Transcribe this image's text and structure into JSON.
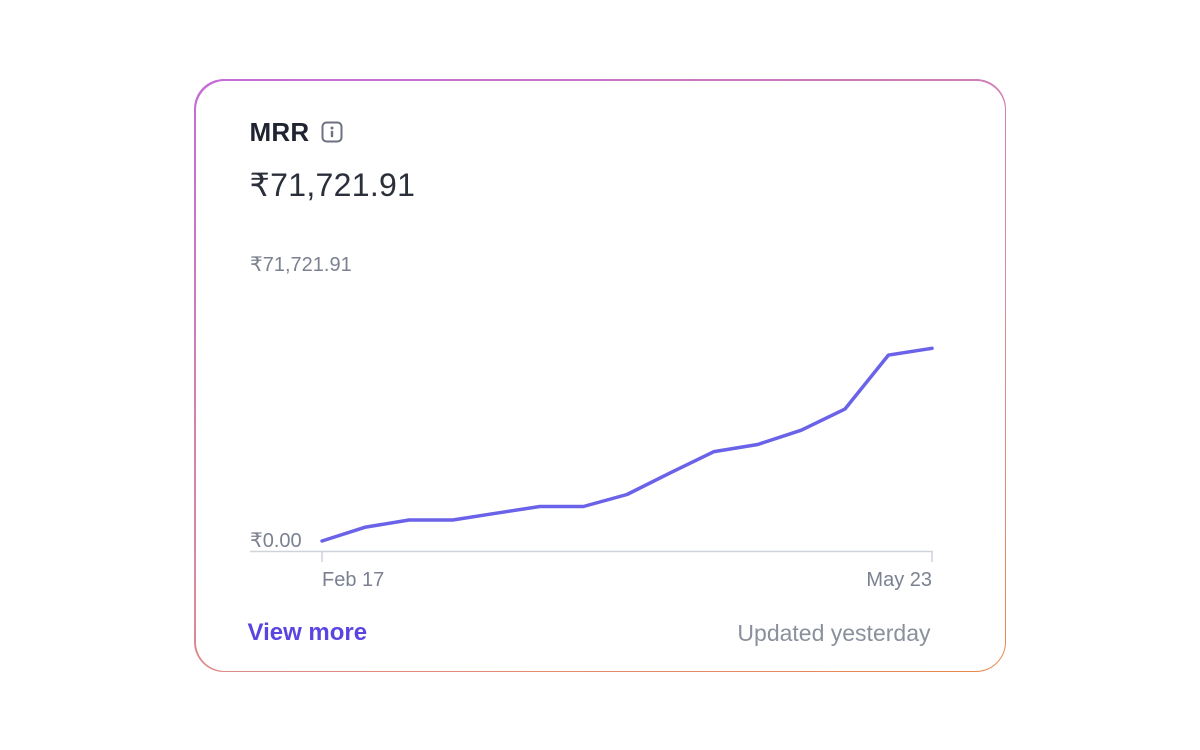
{
  "card": {
    "title": "MRR",
    "value": "₹71,721.91",
    "view_more": "View more",
    "updated": "Updated yesterday"
  },
  "icons": {
    "info": "info-icon"
  },
  "colors": {
    "accent": "#5a45e0",
    "line": "#6a62e8",
    "muted": "#7b8190"
  },
  "chart_data": {
    "type": "line",
    "x_start_label": "Feb 17",
    "x_end_label": "May 23",
    "y_max_label": "₹71,721.91",
    "y_min_label": "₹0.00",
    "ylim": [
      0,
      71721.91
    ],
    "values": [
      1500,
      5000,
      6800,
      6800,
      8500,
      10200,
      10200,
      13200,
      18700,
      24000,
      25800,
      29400,
      34700,
      48300,
      50000
    ]
  }
}
